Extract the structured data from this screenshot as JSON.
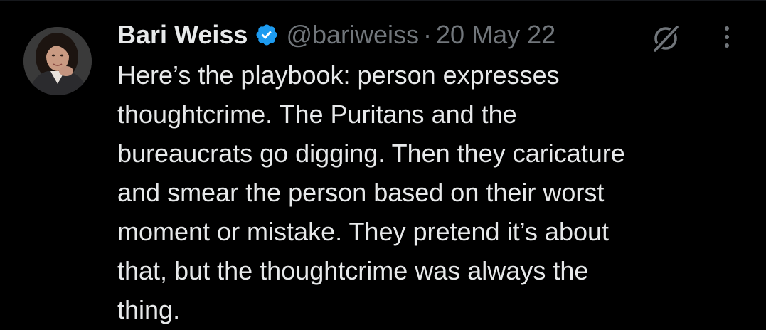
{
  "tweet": {
    "author": {
      "display_name": "Bari Weiss",
      "handle": "@bariweiss",
      "verified": true,
      "avatar_icon": "user-avatar"
    },
    "separator": "·",
    "date": "20 May 22",
    "text": "Here’s the playbook: person expresses\nthoughtcrime. The Puritans and the\nbureaucrats go digging. Then they caricature\nand smear the person based on their worst\nmoment or mistake. They pretend it’s about\nthat, but the thoughtcrime was always the\nthing.",
    "icons": {
      "verified": "verified-badge-icon",
      "grok": "grok-icon",
      "more": "more-options-icon"
    }
  },
  "colors": {
    "background": "#000000",
    "primary_text": "#e7e9ea",
    "secondary_text": "#71767b",
    "verified_blue": "#1d9bf0"
  }
}
